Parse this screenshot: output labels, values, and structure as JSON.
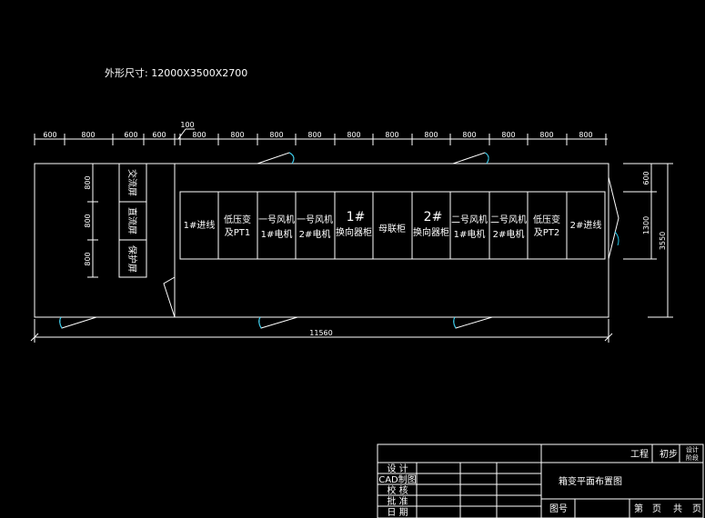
{
  "drawing": {
    "overall_size": "外形尺寸: 12000X3500X2700",
    "top_dims": [
      "600",
      "800",
      "600",
      "600",
      "800",
      "800",
      "800",
      "800",
      "800",
      "800",
      "800",
      "800",
      "800",
      "800",
      "800"
    ],
    "dim_100": "100",
    "total_length": "11560",
    "right_dims": [
      "600",
      "1300",
      "3550"
    ],
    "screens": {
      "vertical_dims": [
        "800",
        "800",
        "800"
      ],
      "labels": [
        "交流屏",
        "直流屏",
        "保护屏"
      ]
    },
    "cabinets": [
      {
        "lines": [
          "1#进线"
        ]
      },
      {
        "lines": [
          "低压变",
          "及PT1"
        ]
      },
      {
        "lines": [
          "一号风机",
          "1#电机"
        ]
      },
      {
        "lines": [
          "一号风机",
          "2#电机"
        ]
      },
      {
        "lines": [
          "1#",
          "换向器柜"
        ]
      },
      {
        "lines": [
          "母联柜"
        ]
      },
      {
        "lines": [
          "2#",
          "换向器柜"
        ]
      },
      {
        "lines": [
          "二号风机",
          "1#电机"
        ]
      },
      {
        "lines": [
          "二号风机",
          "2#电机"
        ]
      },
      {
        "lines": [
          "低压变",
          "及PT2"
        ]
      },
      {
        "lines": [
          "2#进线"
        ]
      }
    ]
  },
  "title_block": {
    "project": "工程",
    "stage1": "初步",
    "stage2_a": "设计",
    "stage2_b": "阶段",
    "drawing_title": "箱变平面布置图",
    "rows": [
      "设 计",
      "CAD制图",
      "校 核",
      "批 准",
      "日 期"
    ],
    "drawing_no": "图号",
    "page_a": "第",
    "page_b": "页",
    "page_c": "共",
    "page_d": "页"
  }
}
